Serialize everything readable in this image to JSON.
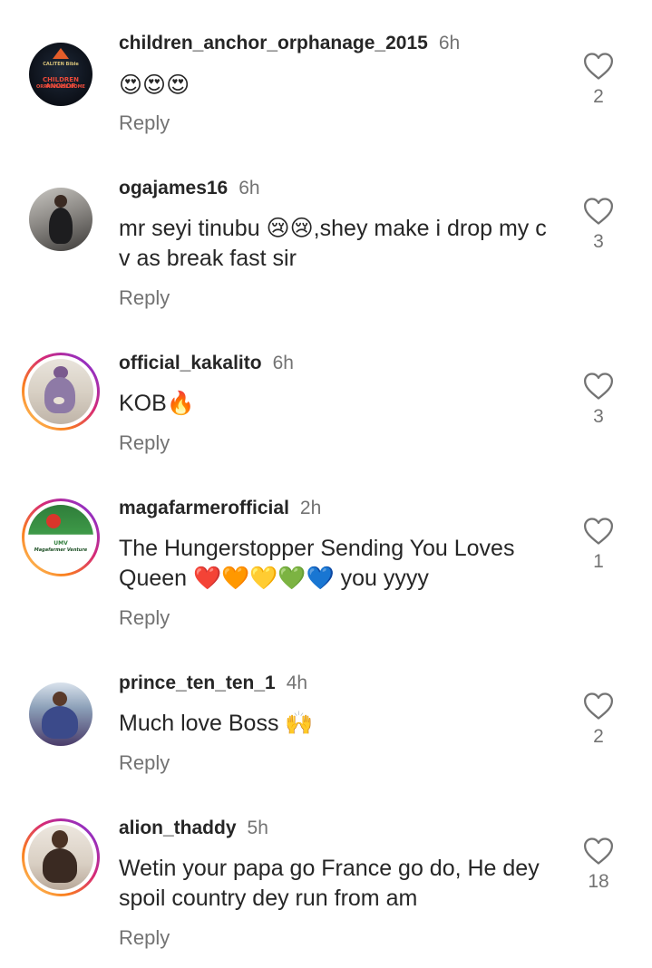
{
  "comments": [
    {
      "username": "children_anchor_orphanage_2015",
      "time": "6h",
      "text": "😍😍😍",
      "reply": "Reply",
      "likes": "2",
      "avatar_text": [
        "CALITEN Bible",
        "CHILDREN ANCHOR",
        "ORPHANAGE HOME"
      ],
      "story_ring": false
    },
    {
      "username": "ogajames16",
      "time": "6h",
      "text": "mr seyi tinubu 😢😢,shey make i drop my c v as break fast sir",
      "reply": "Reply",
      "likes": "3",
      "story_ring": false
    },
    {
      "username": "official_kakalito",
      "time": "6h",
      "text": "KOB🔥",
      "reply": "Reply",
      "likes": "3",
      "story_ring": true
    },
    {
      "username": "magafarmerofficial",
      "time": "2h",
      "text": "The Hungerstopper Sending You Loves Queen ❤️🧡💛💚💙 you yyyy",
      "reply": "Reply",
      "likes": "1",
      "avatar_text": [
        "UMV",
        "Magafarmer Venture"
      ],
      "story_ring": true
    },
    {
      "username": "prince_ten_ten_1",
      "time": "4h",
      "text": "Much love Boss 🙌",
      "reply": "Reply",
      "likes": "2",
      "story_ring": false
    },
    {
      "username": "alion_thaddy",
      "time": "5h",
      "text": "Wetin your papa go France go do, He dey spoil country dey run from am",
      "reply": "Reply",
      "likes": "18",
      "story_ring": true
    }
  ],
  "icons": {
    "like": "heart-outline-icon"
  },
  "colors": {
    "text_primary": "#262626",
    "text_secondary": "#737373",
    "story_gradient": [
      "#feda75",
      "#fa7e1e",
      "#d62976",
      "#962fbf",
      "#4f5bd5"
    ]
  }
}
